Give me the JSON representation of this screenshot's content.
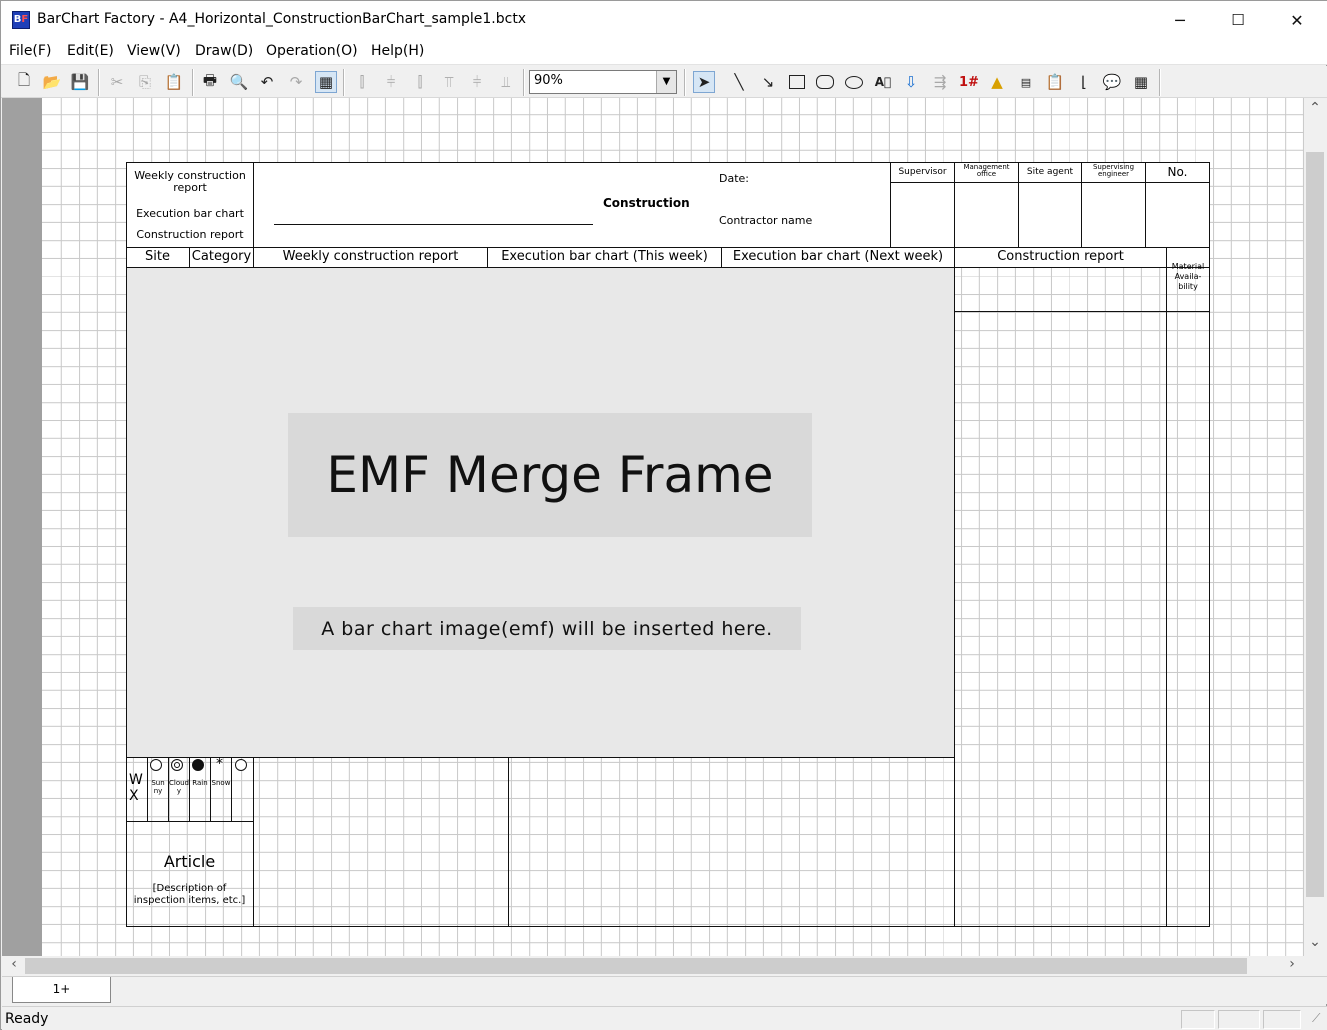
{
  "window": {
    "title": "BarChart Factory - A4_Horizontal_ConstructionBarChart_sample1.bctx",
    "icon_label": "BF",
    "controls": {
      "minimize": "─",
      "maximize": "☐",
      "close": "✕"
    }
  },
  "menu": [
    "File(F)",
    "Edit(E)",
    "View(V)",
    "Draw(D)",
    "Operation(O)",
    "Help(H)"
  ],
  "toolbar": {
    "zoom_value": "90%",
    "icons": [
      "new-file-icon",
      "open-folder-icon",
      "save-icon",
      "cut-icon",
      "copy-icon",
      "paste-icon",
      "print-icon",
      "print-preview-icon",
      "undo-icon",
      "redo-icon",
      "grid-icon",
      "align-left-icon",
      "align-center-icon",
      "align-right-icon",
      "align-top-icon",
      "align-middle-icon",
      "align-bottom-icon",
      "select-arrow-icon",
      "line-icon",
      "arrow-line-icon",
      "rectangle-icon",
      "rounded-rectangle-icon",
      "ellipse-icon",
      "text-box-icon",
      "insert-text-icon",
      "paste-text-icon",
      "insert-number-icon",
      "insert-image-icon",
      "insert-label-icon",
      "insert-clipboard-icon",
      "connector-icon",
      "callout-icon",
      "table-icon"
    ]
  },
  "form": {
    "report_labels": {
      "weekly": "Weekly construction report",
      "execution": "Execution bar chart",
      "construction": "Construction report"
    },
    "title_center": "Construction",
    "date_label": "Date:",
    "contractor_label": "Contractor name",
    "stamps": [
      "Supervisor",
      "Management office",
      "Site agent",
      "Supervising engineer",
      "No."
    ],
    "columns": [
      "Site",
      "Category",
      "Weekly construction report",
      "Execution bar chart (This week)",
      "Execution bar chart (Next week)",
      "Construction report"
    ],
    "material": "Material Availa- bility",
    "merge_title": "EMF Merge Frame",
    "merge_sub": "A bar chart image(emf) will be inserted here.",
    "wx_label": "W X",
    "weather": [
      "Sun ny",
      "Cloud y",
      "Rain",
      "Snow",
      ""
    ],
    "article_title": "Article",
    "article_desc": "[Description of inspection items, etc.]"
  },
  "sheet_tab": "1+",
  "status": "Ready"
}
